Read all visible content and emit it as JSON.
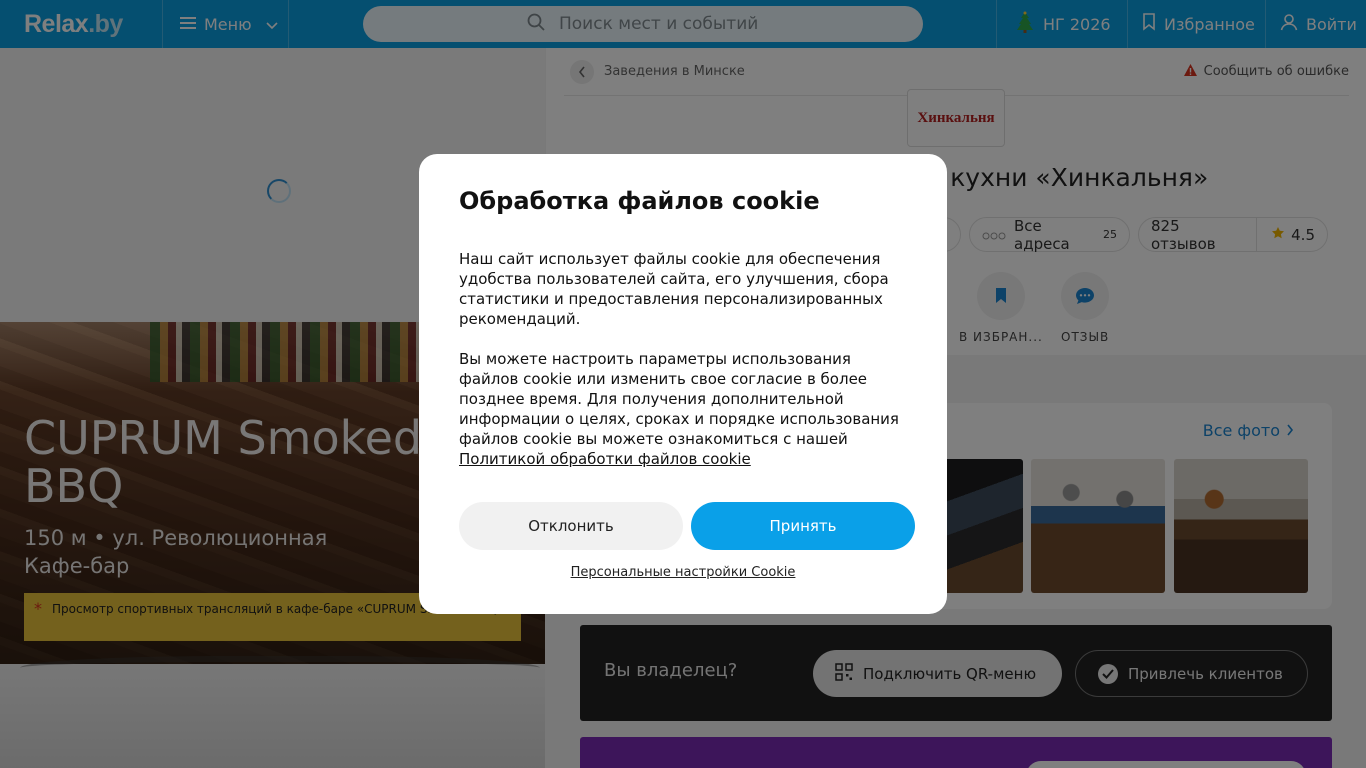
{
  "header": {
    "logo": {
      "main": "Relax",
      "domain": ".by"
    },
    "menu_label": "Меню",
    "search_placeholder": "Поиск мест и событий",
    "ny_label": "НГ 2026",
    "favorites_label": "Избранное",
    "login_label": "Войти"
  },
  "left": {
    "hero_title": "CUPRUM Smoked\nBBQ",
    "hero_distance": "150 м • ул. Революционная",
    "hero_category": "Кафе-бар",
    "promo_text": "Просмотр спортивных трансляций в кафе-баре «CUPRUM Smoked BBQ»"
  },
  "right": {
    "breadcrumb": "Заведения в Минске",
    "report_error": "Сообщить об ошибке",
    "logo_text": "Хинкальня",
    "title_visible": "й кухни «Хинкальня»",
    "all_addresses": "Все адреса",
    "addresses_count": "25",
    "reviews": "825 отзывов",
    "rating": "4.5",
    "action_favorite": "В ИЗБРАН...",
    "action_review": "ОТЗЫВ",
    "all_photos": "Все фото",
    "owner_question": "Вы владелец?",
    "owner_qr": "Подключить QR-меню",
    "owner_attract": "Привлечь клиентов"
  },
  "cookie": {
    "title": "Обработка файлов cookie",
    "paragraph1": "Наш сайт использует файлы cookie для обеспечения удобства пользователей сайта, его улучшения, сбора статистики и предоставления персонализированных рекомендаций.",
    "paragraph2": "Вы можете настроить параметры использования файлов cookie или изменить свое согласие в более позднее время. Для получения дополнительной информации о целях, сроках и порядке использования файлов cookie вы можете ознакомиться с нашей",
    "policy_link": "Политикой обработки файлов cookie",
    "decline": "Отклонить",
    "accept": "Принять",
    "personal_settings": "Персональные настройки Cookie"
  },
  "colors": {
    "brand_blue": "#0a9ee0",
    "accept_blue": "#0aa0e8",
    "promo_yellow": "#e8c33a",
    "rating_star": "#f0b400",
    "warning_red": "#d9331f",
    "owner_dark": "#222222",
    "purple_banner": "#7a2bb5"
  },
  "icons": [
    "search-icon",
    "menu-icon",
    "chevron-down-icon",
    "christmas-tree-icon",
    "bookmark-icon",
    "user-icon",
    "chevron-left-icon",
    "warning-icon",
    "dots-icon",
    "star-icon",
    "chat-icon",
    "chevron-right-icon",
    "qr-icon",
    "check-circle-icon"
  ]
}
